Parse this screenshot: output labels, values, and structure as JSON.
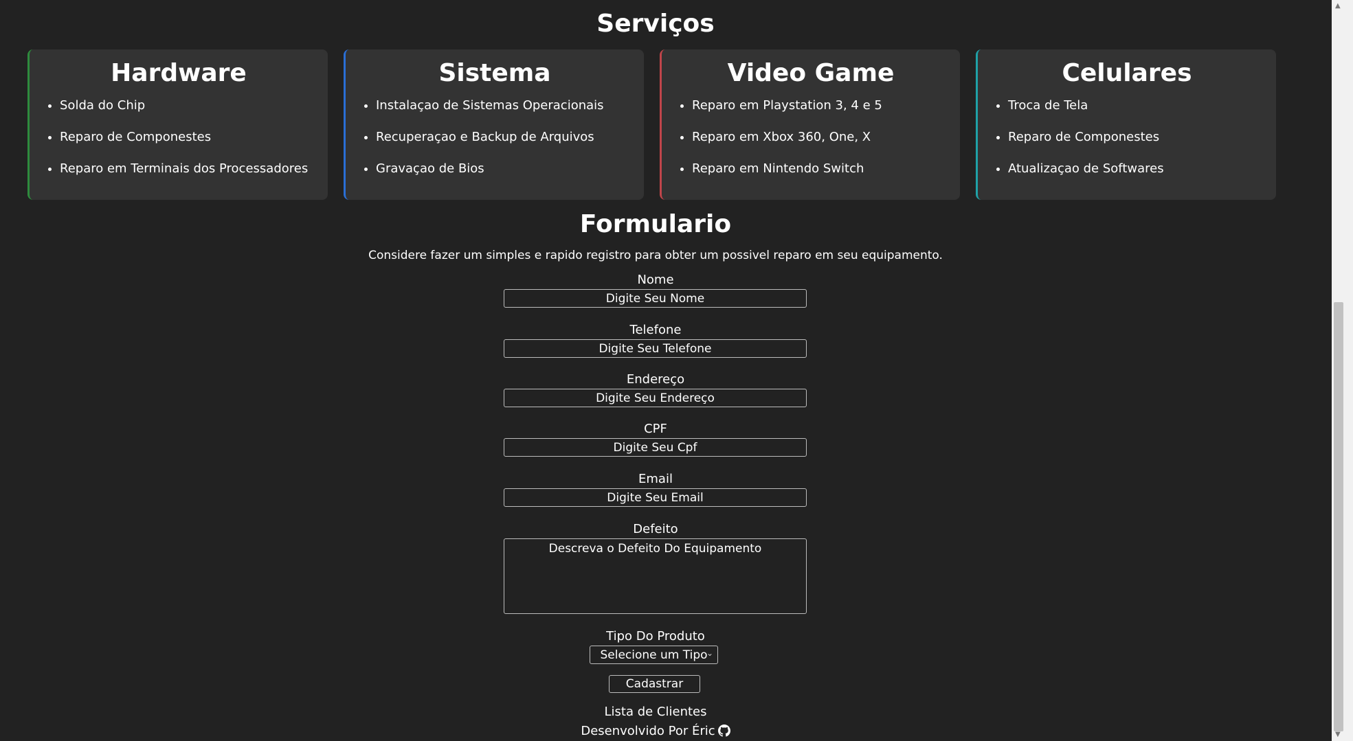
{
  "services": {
    "title": "Serviços",
    "cards": [
      {
        "title": "Hardware",
        "accent": "#2e8b3d",
        "items": [
          "Solda do Chip",
          "Reparo de Componestes",
          "Reparo em Terminais dos Processadores"
        ]
      },
      {
        "title": "Sistema",
        "accent": "#2a6fd6",
        "items": [
          "Instalaçao de Sistemas Operacionais",
          "Recuperaçao e Backup de Arquivos",
          "Gravaçao de Bios"
        ]
      },
      {
        "title": "Video Game",
        "accent": "#c0454a",
        "items": [
          "Reparo em Playstation 3, 4 e 5",
          "Reparo em Xbox 360, One, X",
          "Reparo em Nintendo Switch"
        ]
      },
      {
        "title": "Celulares",
        "accent": "#1fa2a8",
        "items": [
          "Troca de Tela",
          "Reparo de Componestes",
          "Atualizaçao de Softwares"
        ]
      }
    ]
  },
  "form": {
    "title": "Formulario",
    "description": "Considere fazer um simples e rapido registro para obter um possivel reparo em seu equipamento.",
    "fields": {
      "name": {
        "label": "Nome",
        "placeholder": "Digite Seu Nome"
      },
      "phone": {
        "label": "Telefone",
        "placeholder": "Digite Seu Telefone"
      },
      "address": {
        "label": "Endereço",
        "placeholder": "Digite Seu Endereço"
      },
      "cpf": {
        "label": "CPF",
        "placeholder": "Digite Seu Cpf"
      },
      "email": {
        "label": "Email",
        "placeholder": "Digite Seu Email"
      },
      "defect": {
        "label": "Defeito",
        "placeholder": "Descreva o Defeito Do Equipamento"
      },
      "product_type": {
        "label": "Tipo Do Produto",
        "selected": "Selecione um Tipo"
      }
    },
    "submit_label": "Cadastrar"
  },
  "clients_link": "Lista de Clientes",
  "footer": {
    "text": "Desenvolvido Por Éric",
    "icon": "github-icon"
  }
}
